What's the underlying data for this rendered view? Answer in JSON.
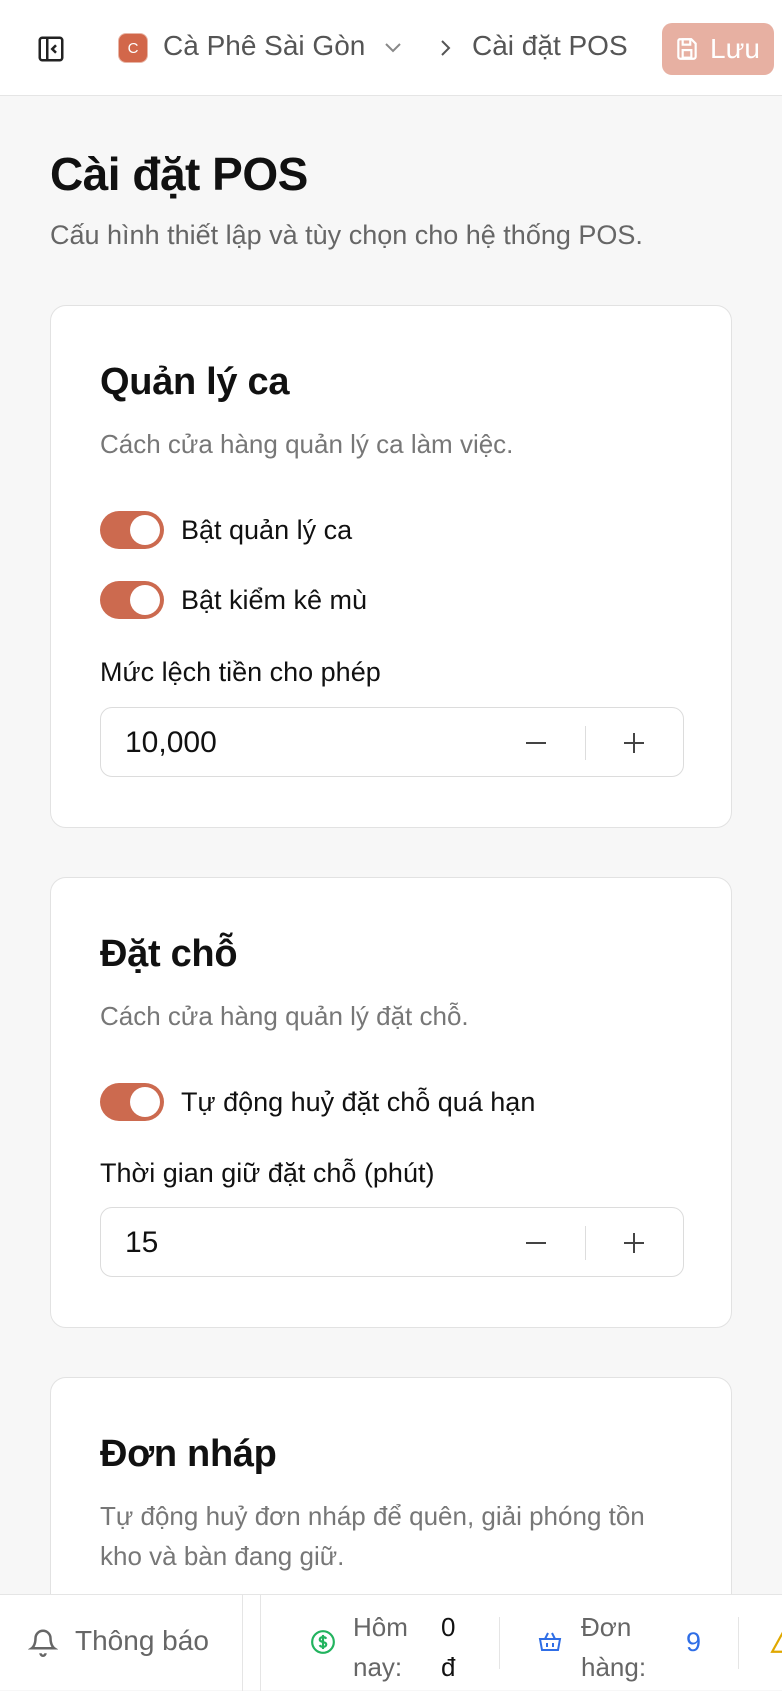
{
  "header": {
    "store_initial": "C",
    "store_name": "Cà Phê Sài Gòn",
    "breadcrumb_current": "Cài đặt POS",
    "save_label": "Lưu"
  },
  "page": {
    "title": "Cài đặt POS",
    "subtitle": "Cấu hình thiết lập và tùy chọn cho hệ thống POS."
  },
  "shift_card": {
    "title": "Quản lý ca",
    "description": "Cách cửa hàng quản lý ca làm việc.",
    "toggles": [
      {
        "label": "Bật quản lý ca",
        "on": true
      },
      {
        "label": "Bật kiểm kê mù",
        "on": true
      }
    ],
    "field_label": "Mức lệch tiền cho phép",
    "field_value": "10,000"
  },
  "reservation_card": {
    "title": "Đặt chỗ",
    "description": "Cách cửa hàng quản lý đặt chỗ.",
    "toggles": [
      {
        "label": "Tự động huỷ đặt chỗ quá hạn",
        "on": true
      }
    ],
    "field_label": "Thời gian giữ đặt chỗ (phút)",
    "field_value": "15"
  },
  "draft_card": {
    "title": "Đơn nháp",
    "description": "Tự động huỷ đơn nháp để quên, giải phóng tồn kho và bàn đang giữ."
  },
  "bottom_bar": {
    "notifications_label": "Thông báo",
    "today_label": "Hôm nay:",
    "today_value": "0 đ",
    "orders_label": "Đơn hàng:",
    "orders_value": "9"
  },
  "colors": {
    "accent": "#cc6a4f",
    "save_button": "#e7b0a2",
    "orders_value": "#2f6ee6",
    "money_icon": "#22b35e",
    "warning_icon": "#e0a800"
  }
}
